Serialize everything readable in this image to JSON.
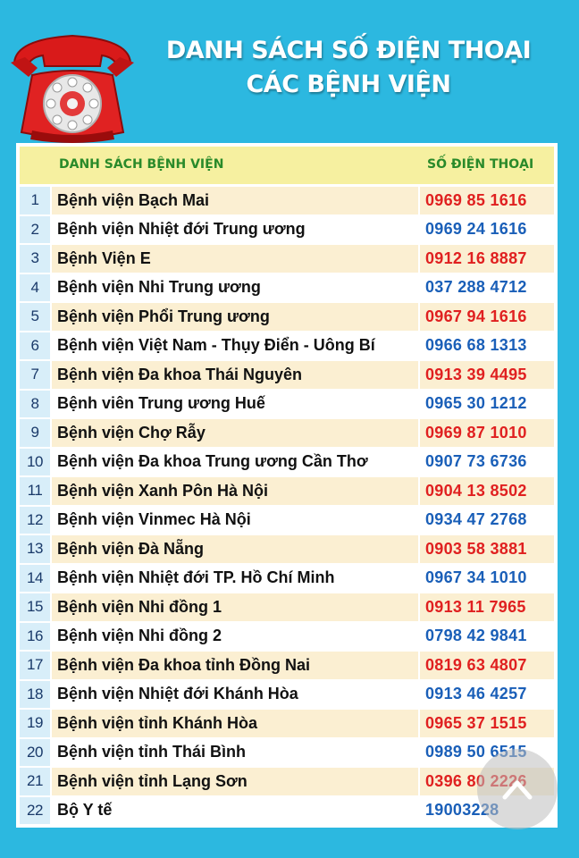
{
  "title_line1": "DANH SÁCH SỐ ĐIỆN THOẠI",
  "title_line2": "CÁC BỆNH VIỆN",
  "table": {
    "col_name": "DANH SÁCH BỆNH VIỆN",
    "col_phone": "SỐ ĐIỆN THOẠI",
    "rows": [
      {
        "num": "1",
        "name": "Bệnh viện Bạch Mai",
        "phone": "0969 85 1616"
      },
      {
        "num": "2",
        "name": "Bệnh viện Nhiệt đới Trung ương",
        "phone": "0969 24 1616"
      },
      {
        "num": "3",
        "name": "Bệnh Viện E",
        "phone": "0912 16 8887"
      },
      {
        "num": "4",
        "name": "Bệnh viện Nhi Trung ương",
        "phone": "037 288 4712"
      },
      {
        "num": "5",
        "name": "Bệnh viện Phổi Trung ương",
        "phone": "0967 94 1616"
      },
      {
        "num": "6",
        "name": "Bệnh viện Việt Nam - Thụy Điển - Uông Bí",
        "phone": "0966 68 1313"
      },
      {
        "num": "7",
        "name": "Bệnh viện Đa khoa Thái Nguyên",
        "phone": "0913 39 4495"
      },
      {
        "num": "8",
        "name": "Bệnh viên Trung ương Huế",
        "phone": "0965 30 1212"
      },
      {
        "num": "9",
        "name": "Bệnh viện Chợ Rẫy",
        "phone": "0969 87 1010"
      },
      {
        "num": "10",
        "name": "Bệnh viện Đa khoa Trung ương Cần Thơ",
        "phone": "0907 73 6736"
      },
      {
        "num": "11",
        "name": "Bệnh viện Xanh Pôn Hà Nội",
        "phone": "0904 13 8502"
      },
      {
        "num": "12",
        "name": "Bệnh viện Vinmec Hà Nội",
        "phone": "0934 47 2768"
      },
      {
        "num": "13",
        "name": "Bệnh viện Đà Nẵng",
        "phone": "0903 58 3881"
      },
      {
        "num": "14",
        "name": "Bệnh viện Nhiệt đới TP. Hồ Chí Minh",
        "phone": "0967 34 1010"
      },
      {
        "num": "15",
        "name": "Bệnh viện Nhi đồng 1",
        "phone": "0913 11 7965"
      },
      {
        "num": "16",
        "name": "Bệnh viện Nhi đồng 2",
        "phone": "0798 42 9841"
      },
      {
        "num": "17",
        "name": "Bệnh viện Đa khoa tỉnh Đồng Nai",
        "phone": "0819 63 4807"
      },
      {
        "num": "18",
        "name": "Bệnh viện Nhiệt đới Khánh Hòa",
        "phone": "0913 46 4257"
      },
      {
        "num": "19",
        "name": "Bệnh viện tỉnh Khánh Hòa",
        "phone": "0965 37 1515"
      },
      {
        "num": "20",
        "name": "Bệnh viện tỉnh Thái Bình",
        "phone": "0989 50 6515"
      },
      {
        "num": "21",
        "name": "Bệnh viện tỉnh Lạng Sơn",
        "phone": "0396 80 2226"
      },
      {
        "num": "22",
        "name": "Bộ Y tế",
        "phone": "19003228"
      }
    ]
  },
  "icons": {
    "phone": "telephone-icon",
    "scroll_top": "chevron-up-icon"
  },
  "colors": {
    "background": "#2cb8e0",
    "header_bg": "#f6f0a0",
    "header_text": "#2a8a2a",
    "phone_red": "#e02020",
    "phone_blue": "#1a5fb8",
    "row_alt": "#fbefd2"
  }
}
